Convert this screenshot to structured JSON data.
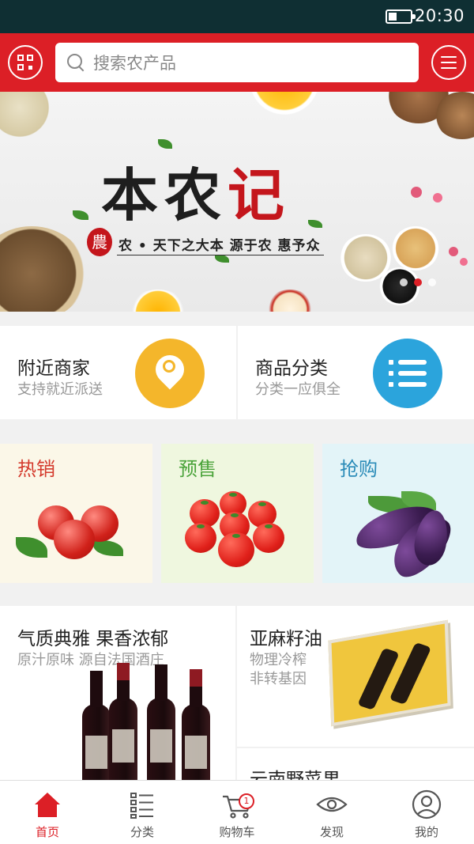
{
  "status_bar": {
    "time": "20:30",
    "battery_icon": "battery-icon"
  },
  "header": {
    "search_placeholder": "搜索农产品",
    "left_icon": "qr-scan-icon",
    "right_icon": "menu-icon",
    "accent": "#dc1f26"
  },
  "banner": {
    "title_part1": "本农",
    "title_part2": "记",
    "seal": "農",
    "slogan": "农 • 天下之大本     源于农  惠予众",
    "dots": 3,
    "active_dot": 1
  },
  "services": [
    {
      "title": "附近商家",
      "subtitle": "支持就近派送",
      "icon": "location-search-icon",
      "color": "#f4b62b"
    },
    {
      "title": "商品分类",
      "subtitle": "分类一应俱全",
      "icon": "category-list-icon",
      "color": "#2ba4dc"
    }
  ],
  "promos": [
    {
      "title": "热销",
      "color": "#d43a2c"
    },
    {
      "title": "预售",
      "color": "#4aa33a"
    },
    {
      "title": "抢购",
      "color": "#2a8bb8"
    }
  ],
  "products": {
    "left": {
      "title": "气质典雅 果香浓郁",
      "subtitle": "原汁原味 源自法国酒庄"
    },
    "right_top": {
      "title": "亚麻籽油",
      "subtitle_line1": "物理冷榨",
      "subtitle_line2": "非转基因"
    },
    "right_bottom": {
      "title": "云南野菜果"
    }
  },
  "tabbar": {
    "items": [
      {
        "label": "首页",
        "icon": "home-icon",
        "active": true
      },
      {
        "label": "分类",
        "icon": "category-icon",
        "active": false
      },
      {
        "label": "购物车",
        "icon": "cart-icon",
        "active": false,
        "badge": "1"
      },
      {
        "label": "发现",
        "icon": "eye-icon",
        "active": false
      },
      {
        "label": "我的",
        "icon": "user-icon",
        "active": false
      }
    ]
  }
}
